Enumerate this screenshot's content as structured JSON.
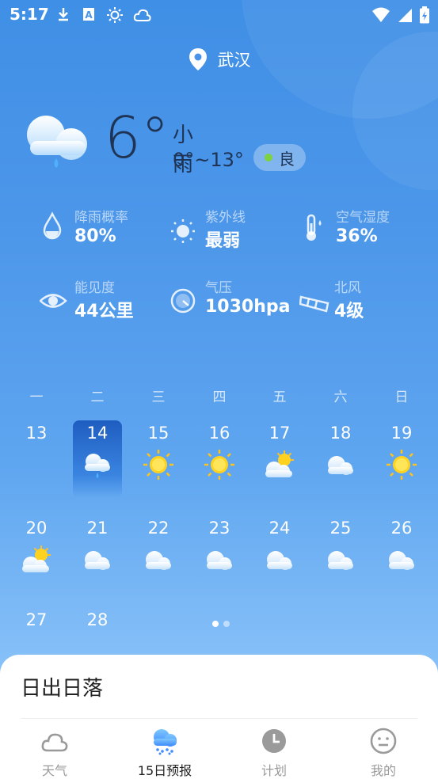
{
  "status_bar": {
    "time": "5:17",
    "icons": [
      "download-icon",
      "text-a-icon",
      "sun-icon",
      "cloud-icon"
    ],
    "right_icons": [
      "wifi-icon",
      "signal-icon",
      "battery-icon"
    ]
  },
  "location": {
    "city": "武汉"
  },
  "current": {
    "temp": "6°",
    "condition": "小雨",
    "range": "0°~13°",
    "aqi": "良",
    "icon": "cloud-rain-icon"
  },
  "stats": [
    {
      "label": "降雨概率",
      "value": "80%",
      "icon": "raindrop-icon"
    },
    {
      "label": "紫外线",
      "value": "最弱",
      "icon": "sun-icon"
    },
    {
      "label": "空气湿度",
      "value": "36%",
      "icon": "thermometer-icon"
    },
    {
      "label": "能见度",
      "value": "44公里",
      "icon": "eye-icon"
    },
    {
      "label": "气压",
      "value": "1030hpa",
      "icon": "gauge-icon"
    },
    {
      "label": "北风",
      "value": "4级",
      "icon": "windsock-icon"
    }
  ],
  "calendar": {
    "weekdays": [
      "一",
      "二",
      "三",
      "四",
      "五",
      "六",
      "日"
    ],
    "rows": [
      [
        {
          "day": "13",
          "icon": ""
        },
        {
          "day": "14",
          "icon": "cloud-rain-icon",
          "selected": true
        },
        {
          "day": "15",
          "icon": "sun-icon"
        },
        {
          "day": "16",
          "icon": "sun-icon"
        },
        {
          "day": "17",
          "icon": "sun-cloud-icon"
        },
        {
          "day": "18",
          "icon": "cloud-icon"
        },
        {
          "day": "19",
          "icon": "sun-icon"
        }
      ],
      [
        {
          "day": "20",
          "icon": "sun-cloud-icon"
        },
        {
          "day": "21",
          "icon": "cloud-icon"
        },
        {
          "day": "22",
          "icon": "cloud-icon"
        },
        {
          "day": "23",
          "icon": "cloud-icon"
        },
        {
          "day": "24",
          "icon": "cloud-icon"
        },
        {
          "day": "25",
          "icon": "cloud-icon"
        },
        {
          "day": "26",
          "icon": "cloud-icon"
        }
      ],
      [
        {
          "day": "27",
          "icon": ""
        },
        {
          "day": "28",
          "icon": ""
        }
      ]
    ]
  },
  "pager": {
    "count": 2,
    "active": 0
  },
  "sheet": {
    "title": "日出日落"
  },
  "tabs": [
    {
      "label": "天气",
      "icon": "cloud-icon",
      "active": false
    },
    {
      "label": "15日预报",
      "icon": "cloud-rain-icon",
      "active": true
    },
    {
      "label": "计划",
      "icon": "clock-icon",
      "active": false
    },
    {
      "label": "我的",
      "icon": "smiley-icon",
      "active": false
    }
  ],
  "colors": {
    "bg_top": "#3f8fe6",
    "bg_bottom": "#a9d3fb",
    "text_dark": "#1f3454",
    "aqi_good": "#7cd33f",
    "sun": "#ffd21f",
    "tab_inactive": "#999999",
    "tab_active": "#222222"
  }
}
